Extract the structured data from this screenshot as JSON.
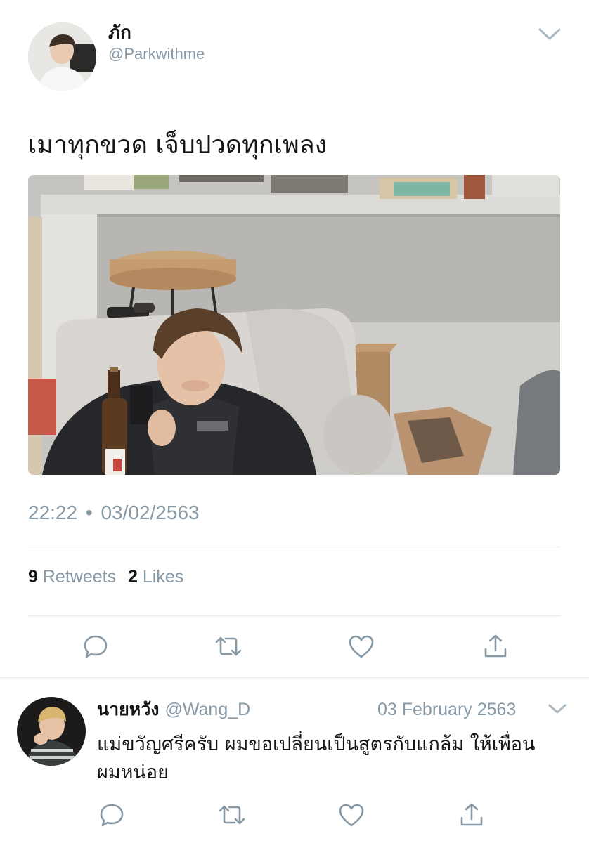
{
  "tweet": {
    "display_name": "ภัก",
    "handle": "@Parkwithme",
    "text": "เมาทุกขวด เจ็บปวดทุกเพลง",
    "time": "22:22",
    "separator": "•",
    "date": "03/02/2563",
    "retweets_count": "9",
    "retweets_label": "Retweets",
    "likes_count": "2",
    "likes_label": "Likes"
  },
  "reply": {
    "display_name": "นายหวัง",
    "handle": "@Wang_D",
    "date": "03 February 2563",
    "text": "แม่ขวัญศรีครับ ผมขอเปลี่ยนเป็นสูตรกับแกล้ม ให้เพื่อนผมหน่อย"
  },
  "icons": {
    "reply": "reply-icon",
    "retweet": "retweet-icon",
    "like": "heart-icon",
    "share": "share-icon",
    "menu": "chevron-down-icon"
  },
  "colors": {
    "text": "#14171a",
    "muted": "#8899a6",
    "divider": "#e1e8ed"
  }
}
